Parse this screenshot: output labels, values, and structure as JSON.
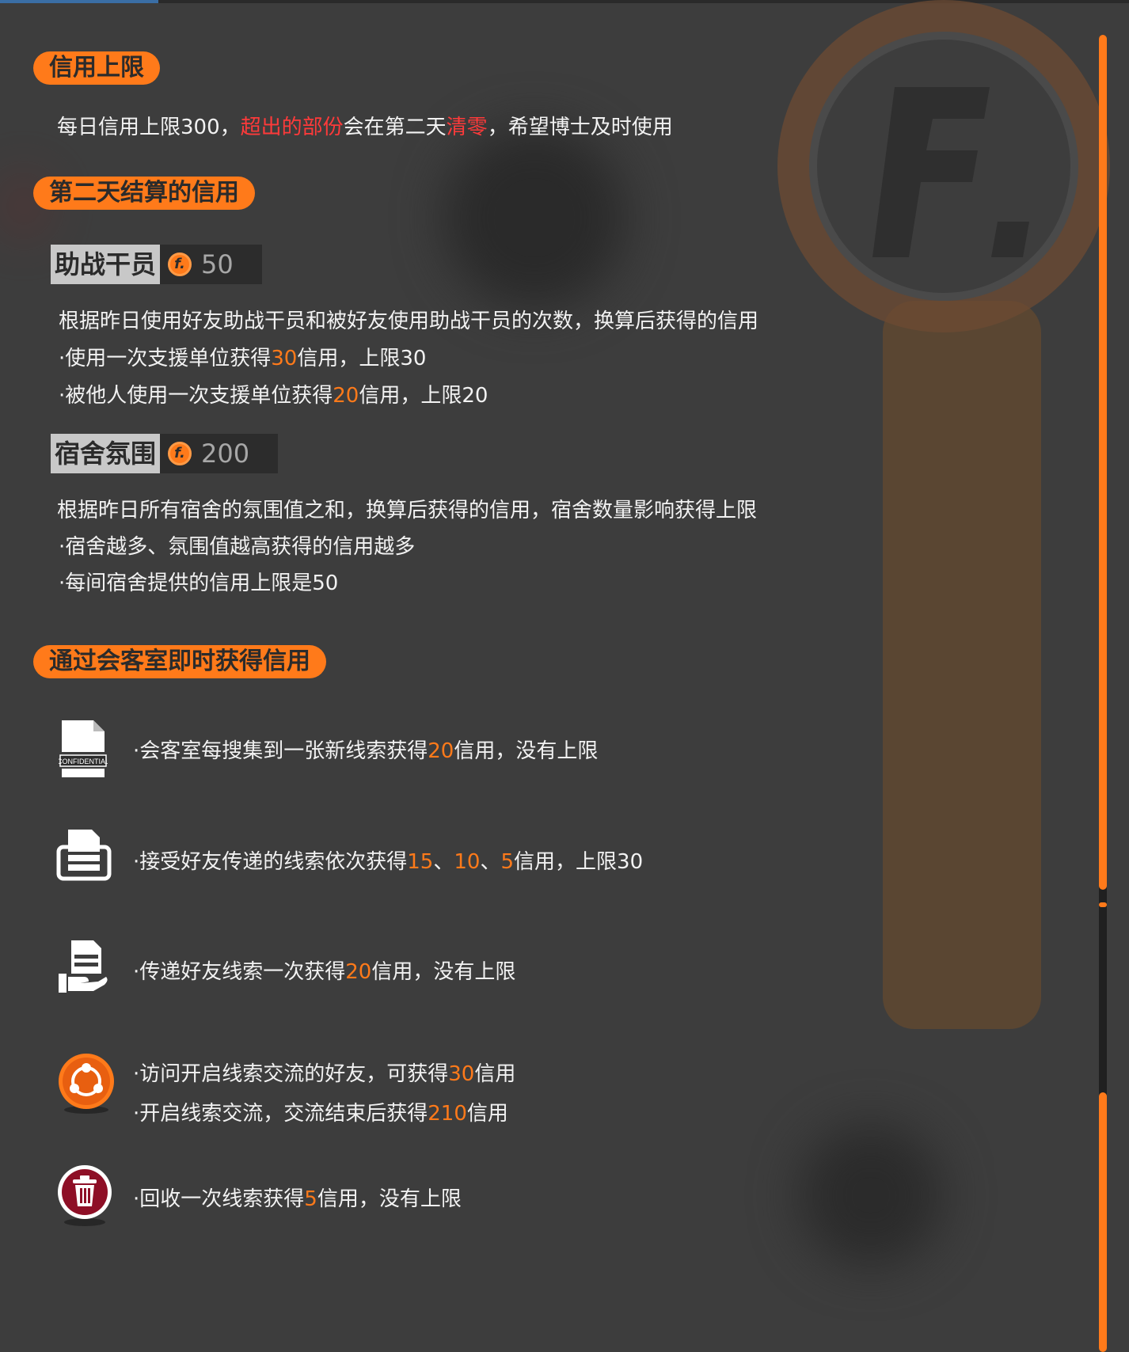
{
  "credit_limit": {
    "header": "信用上限",
    "desc_parts": [
      "每日信用上限300，",
      "超出的部份",
      "会在第二天",
      "清零",
      "，希望博士及时使用"
    ]
  },
  "next_day": {
    "header": "第二天结算的信用",
    "support": {
      "name": "助战干员",
      "value": "50",
      "desc": "根据昨日使用好友助战干员和被好友使用助战干员的次数，换算后获得的信用",
      "line1_parts": [
        "·使用一次支援单位获得",
        "30",
        "信用，上限30"
      ],
      "line2_parts": [
        "·被他人使用一次支援单位获得",
        "20",
        "信用，上限20"
      ]
    },
    "dorm": {
      "name": "宿舍氛围",
      "value": "200",
      "desc": "根据昨日所有宿舍的氛围值之和，换算后获得的信用，宿舍数量影响获得上限",
      "line1": "·宿舍越多、氛围值越高获得的信用越多",
      "line2": "·每间宿舍提供的信用上限是50"
    }
  },
  "reception": {
    "header": "通过会客室即时获得信用",
    "item1_parts": [
      "·会客室每搜集到一张新线索获得",
      "20",
      "信用，没有上限"
    ],
    "item2_parts": [
      "·接受好友传递的线索依次获得",
      "15",
      "、",
      "10",
      "、",
      "5",
      "信用，上限30"
    ],
    "item3_parts": [
      "·传递好友线索一次获得",
      "20",
      "信用，没有上限"
    ],
    "item4a_parts": [
      "·访问开启线索交流的好友，可获得",
      "30",
      "信用"
    ],
    "item4b_parts": [
      "·开启线索交流，交流结束后获得",
      "210",
      "信用"
    ],
    "item5_parts": [
      "·回收一次线索获得",
      "5",
      "信用，没有上限"
    ],
    "confidential_label": "CONFIDENTIAL",
    "coin_glyph": "f."
  },
  "icons": [
    "confidential-file-icon",
    "printer-icon",
    "hand-give-document-icon",
    "share-exchange-icon",
    "trash-icon"
  ],
  "colors": {
    "accent": "#ff7a1a",
    "highlight_red": "#ff3a3a",
    "background": "#3d3d3d"
  }
}
